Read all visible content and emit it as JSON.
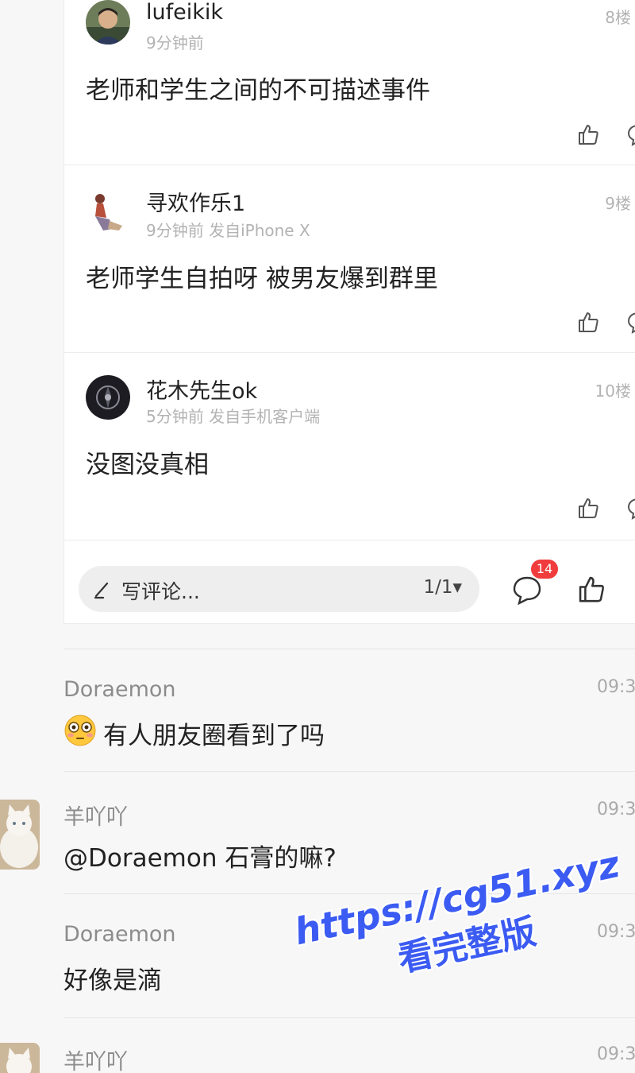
{
  "thread": {
    "posts": [
      {
        "name": "lufeikik",
        "meta": "9分钟前",
        "floor": "8楼",
        "content": "老师和学生之间的不可描述事件",
        "avatar_icon": "person-photo-avatar"
      },
      {
        "name": "寻欢作乐1",
        "meta": "9分钟前 发自iPhone X",
        "floor": "9楼",
        "content": "老师学生自拍呀 被男友爆到群里",
        "avatar_icon": "figure-illustration-avatar"
      },
      {
        "name": "花木先生ok",
        "meta": "5分钟前 发自手机客户端",
        "floor": "10楼",
        "content": "没图没真相",
        "avatar_icon": "dark-circle-avatar"
      }
    ],
    "comment_bar": {
      "placeholder": "写评论...",
      "page_indicator": "1/1▾",
      "comment_count": "14"
    }
  },
  "chat": {
    "messages": [
      {
        "sender": "Doraemon",
        "time": "09:3",
        "text": "有人朋友圈看到了吗",
        "emoji": "flushed-face"
      },
      {
        "sender": "羊吖吖",
        "time": "09:3",
        "text": "@Doraemon 石膏的嘛?"
      },
      {
        "sender": "Doraemon",
        "time": "09:3",
        "text": "好像是滴"
      },
      {
        "sender": "羊吖吖",
        "time": "09:3"
      }
    ]
  },
  "watermark": {
    "url": "https://cg51.xyz",
    "subtitle": "看完整版",
    "color": "#3b5bf2"
  }
}
